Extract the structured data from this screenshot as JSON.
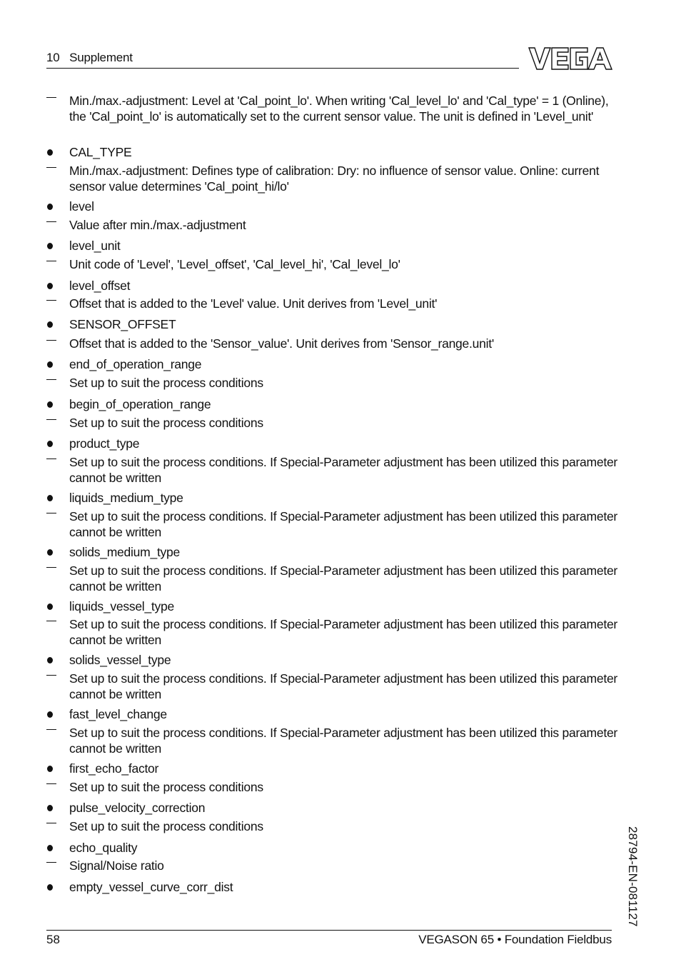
{
  "header": {
    "section": "10   Supplement",
    "logo_text": "VEGA"
  },
  "entries": [
    {
      "type": "dash",
      "text": "Min./max.-adjustment: Level at 'Cal_point_lo'. When writing 'Cal_level_lo' and 'Cal_type' = 1 (Online), the 'Cal_point_lo' is automatically set to the current sensor value. The unit is defined in 'Level_unit'"
    },
    {
      "type": "bullet",
      "text": "CAL_TYPE"
    },
    {
      "type": "dash",
      "text": "Min./max.-adjustment: Defines type of calibration: Dry: no influence of sensor value. Online: current sensor value determines 'Cal_point_hi/lo'"
    },
    {
      "type": "bullet",
      "text": "level"
    },
    {
      "type": "dash",
      "text": "Value after min./max.-adjustment"
    },
    {
      "type": "bullet",
      "text": "level_unit"
    },
    {
      "type": "dash",
      "text": "Unit code of 'Level', 'Level_offset', 'Cal_level_hi', 'Cal_level_lo'"
    },
    {
      "type": "bullet",
      "text": "level_offset"
    },
    {
      "type": "dash",
      "text": "Offset that is added to the 'Level' value. Unit derives from 'Level_unit'"
    },
    {
      "type": "bullet",
      "text": "SENSOR_OFFSET"
    },
    {
      "type": "dash",
      "text": "Offset that is added to the 'Sensor_value'. Unit derives from 'Sensor_range.unit'"
    },
    {
      "type": "bullet",
      "text": "end_of_operation_range"
    },
    {
      "type": "dash",
      "text": "Set up to suit the process conditions"
    },
    {
      "type": "bullet",
      "text": "begin_of_operation_range"
    },
    {
      "type": "dash",
      "text": "Set up to suit the process conditions"
    },
    {
      "type": "bullet",
      "text": "product_type"
    },
    {
      "type": "dash",
      "text": "Set up to suit the process conditions. If Special-Parameter adjustment has been utilized this parameter cannot be written"
    },
    {
      "type": "bullet",
      "text": "liquids_medium_type"
    },
    {
      "type": "dash",
      "text": "Set up to suit the process conditions. If Special-Parameter adjustment has been utilized this parameter cannot be written"
    },
    {
      "type": "bullet",
      "text": "solids_medium_type"
    },
    {
      "type": "dash",
      "text": "Set up to suit the process conditions. If Special-Parameter adjustment has been utilized this parameter cannot be written"
    },
    {
      "type": "bullet",
      "text": "liquids_vessel_type"
    },
    {
      "type": "dash",
      "text": "Set up to suit the process conditions. If Special-Parameter adjustment has been utilized this parameter cannot be written"
    },
    {
      "type": "bullet",
      "text": "solids_vessel_type"
    },
    {
      "type": "dash",
      "text": "Set up to suit the process conditions. If Special-Parameter adjustment has been utilized this parameter cannot be written"
    },
    {
      "type": "bullet",
      "text": "fast_level_change"
    },
    {
      "type": "dash",
      "text": "Set up to suit the process conditions. If Special-Parameter adjustment has been utilized this parameter cannot be written"
    },
    {
      "type": "bullet",
      "text": "first_echo_factor"
    },
    {
      "type": "dash",
      "text": "Set up to suit the process conditions"
    },
    {
      "type": "bullet",
      "text": "pulse_velocity_correction"
    },
    {
      "type": "dash",
      "text": "Set up to suit the process conditions"
    },
    {
      "type": "bullet",
      "text": "echo_quality"
    },
    {
      "type": "dash",
      "text": "Signal/Noise ratio"
    },
    {
      "type": "bullet",
      "text": "empty_vessel_curve_corr_dist"
    }
  ],
  "side_code": "28794-EN-081127",
  "footer": {
    "page_number": "58",
    "product": "VEGASON 65 • Foundation Fieldbus"
  }
}
